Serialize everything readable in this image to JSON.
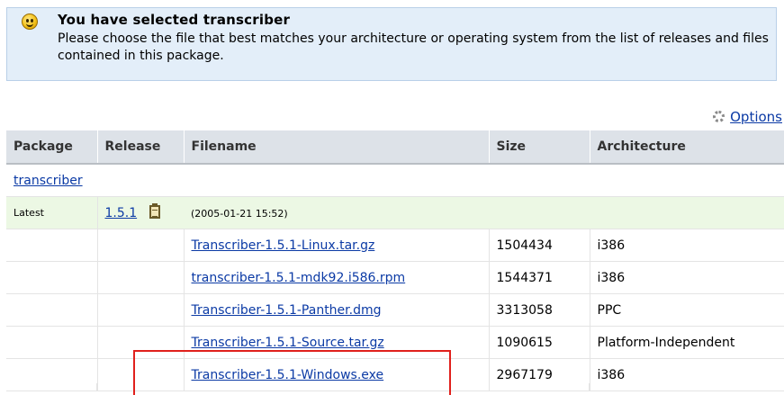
{
  "notice": {
    "icon": "smiley-icon",
    "title": "You have selected transcriber",
    "text": "Please choose the file that best matches your architecture or operating system from the list of releases and files contained in this package."
  },
  "options": {
    "icon": "gear-icon",
    "label": "Options"
  },
  "table": {
    "headers": [
      "Package",
      "Release",
      "Filename",
      "Size",
      "Architecture"
    ],
    "package_name": "transcriber",
    "latest_label": "Latest",
    "release": {
      "version": "1.5.1",
      "notes_icon": "clipboard-icon",
      "date": "(2005-01-21 15:52)"
    },
    "files": [
      {
        "filename": "Transcriber-1.5.1-Linux.tar.gz",
        "size": "1504434",
        "arch": "i386"
      },
      {
        "filename": "transcriber-1.5.1-mdk92.i586.rpm",
        "size": "1544371",
        "arch": "i386"
      },
      {
        "filename": "Transcriber-1.5.1-Panther.dmg",
        "size": "3313058",
        "arch": "PPC"
      },
      {
        "filename": "Transcriber-1.5.1-Source.tar.gz",
        "size": "1090615",
        "arch": "Platform-Independent"
      },
      {
        "filename": "Transcriber-1.5.1-Windows.exe",
        "size": "2967179",
        "arch": "i386"
      }
    ]
  },
  "colors": {
    "notice_bg": "#e3eef9",
    "latest_row_bg": "#ecf8e4",
    "link": "#0b3aa5",
    "highlight_border": "#e0201c"
  }
}
